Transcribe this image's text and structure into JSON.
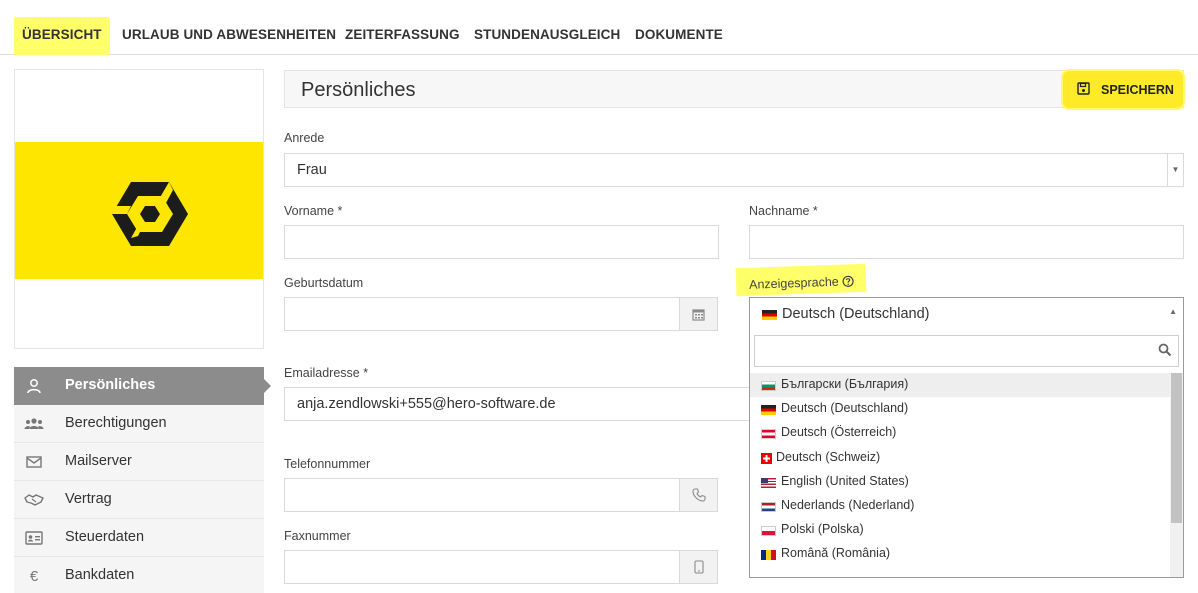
{
  "tabs": [
    {
      "label": "ÜBERSICHT",
      "active": true
    },
    {
      "label": "URLAUB UND ABWESENHEITEN"
    },
    {
      "label": "ZEITERFASSUNG"
    },
    {
      "label": "STUNDENAUSGLEICH"
    },
    {
      "label": "DOKUMENTE"
    }
  ],
  "brand": {
    "accent": "#ffe600",
    "highlight": "#ffff6a",
    "active_nav": "#8c8c8c"
  },
  "sidebar": {
    "items": [
      {
        "label": "Persönliches",
        "icon": "user-icon",
        "active": true
      },
      {
        "label": "Berechtigungen",
        "icon": "users-icon"
      },
      {
        "label": "Mailserver",
        "icon": "envelope-icon"
      },
      {
        "label": "Vertrag",
        "icon": "handshake-icon"
      },
      {
        "label": "Steuerdaten",
        "icon": "id-card-icon"
      },
      {
        "label": "Bankdaten",
        "icon": "euro-icon"
      }
    ]
  },
  "header": {
    "title": "Persönliches",
    "save_label": "SPEICHERN"
  },
  "form": {
    "anrede": {
      "label": "Anrede",
      "value": "Frau"
    },
    "vorname": {
      "label": "Vorname *",
      "value": ""
    },
    "nachname": {
      "label": "Nachname *",
      "value": ""
    },
    "geburtsdatum": {
      "label": "Geburtsdatum",
      "value": ""
    },
    "anzeigesprache": {
      "label": "Anzeigesprache",
      "help_icon": "question-circle-icon",
      "value": "Deutsch (Deutschland)"
    },
    "email": {
      "label": "Emailadresse *",
      "value": "anja.zendlowski+555@hero-software.de"
    },
    "telefon": {
      "label": "Telefonnummer",
      "value": ""
    },
    "fax": {
      "label": "Faxnummer",
      "value": ""
    }
  },
  "language_dropdown": {
    "search_value": "",
    "options": [
      {
        "label": "Български (България)",
        "flag": "bg",
        "hover": true
      },
      {
        "label": "Deutsch (Deutschland)",
        "flag": "de"
      },
      {
        "label": "Deutsch (Österreich)",
        "flag": "at"
      },
      {
        "label": "Deutsch (Schweiz)",
        "flag": "ch"
      },
      {
        "label": "English (United States)",
        "flag": "us"
      },
      {
        "label": "Nederlands (Nederland)",
        "flag": "nl"
      },
      {
        "label": "Polski (Polska)",
        "flag": "pl"
      },
      {
        "label": "Română (România)",
        "flag": "ro"
      }
    ]
  }
}
